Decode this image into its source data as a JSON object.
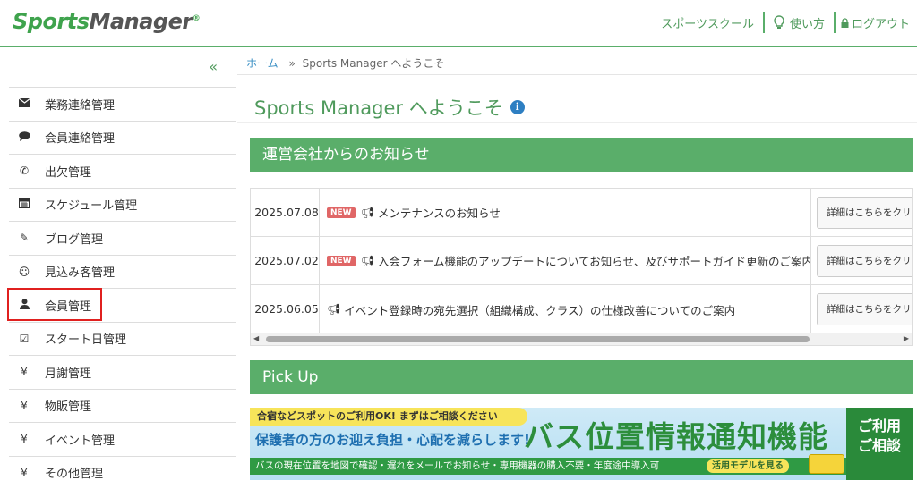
{
  "header": {
    "logo_part1": "Sports",
    "logo_part2": "Manager",
    "logo_mark": "®",
    "nav": [
      {
        "label": "スポーツスクール"
      },
      {
        "label": "使い方",
        "icon": "lightbulb-icon"
      },
      {
        "label": "ログアウト",
        "icon": "lock-icon"
      }
    ]
  },
  "sidebar": {
    "collapse_glyph": "«",
    "items": [
      {
        "label": "業務連絡管理",
        "icon": "envelope-icon"
      },
      {
        "label": "会員連絡管理",
        "icon": "speech-bubble-icon"
      },
      {
        "label": "出欠管理",
        "icon": "phone-icon"
      },
      {
        "label": "スケジュール管理",
        "icon": "calendar-icon"
      },
      {
        "label": "ブログ管理",
        "icon": "pencil-icon"
      },
      {
        "label": "見込み客管理",
        "icon": "smiley-icon"
      },
      {
        "label": "会員管理",
        "icon": "user-icon"
      },
      {
        "label": "スタート日管理",
        "icon": "checkbox-icon"
      },
      {
        "label": "月謝管理",
        "icon": "yen-icon"
      },
      {
        "label": "物販管理",
        "icon": "yen-icon"
      },
      {
        "label": "イベント管理",
        "icon": "yen-icon"
      },
      {
        "label": "その他管理",
        "icon": "yen-icon"
      }
    ]
  },
  "breadcrumb": {
    "home": "ホーム",
    "separator": "»",
    "current": "Sports Manager へようこそ"
  },
  "main": {
    "title": "Sports Manager へようこそ",
    "notices_heading": "運営会社からのお知らせ",
    "notices": [
      {
        "date": "2025.07.08",
        "new": true,
        "text": "メンテナンスのお知らせ",
        "button": "詳細はこちらをクリ"
      },
      {
        "date": "2025.07.02",
        "new": true,
        "text": "入会フォーム機能のアップデートについてお知らせ、及びサポートガイド更新のご案内",
        "button": "詳細はこちらをクリ"
      },
      {
        "date": "2025.06.05",
        "new": false,
        "text": "イベント登録時の宛先選択（組織構成、クラス）の仕様改善についてのご案内",
        "button": "詳細はこちらをクリ"
      }
    ],
    "new_badge": "NEW",
    "pickup_heading": "Pick Up",
    "banner": {
      "top": "合宿などスポットのご利用OK! まずはご相談ください",
      "sub": "保護者の方のお迎え負担・心配を減らします!",
      "big": "バス位置情報通知機能",
      "bottom": "バスの現在位置を地図で確認・遅れをメールでお知らせ・専用機器の購入不要・年度途中導入可",
      "model": "活用モデルを見る",
      "cta_line1": "ご利用",
      "cta_line2": "ご相談"
    }
  },
  "colors": {
    "brand_green": "#5aae6a",
    "link_blue": "#3a8fc4",
    "highlight_red": "#e0201f",
    "badge_red": "#e06666"
  }
}
